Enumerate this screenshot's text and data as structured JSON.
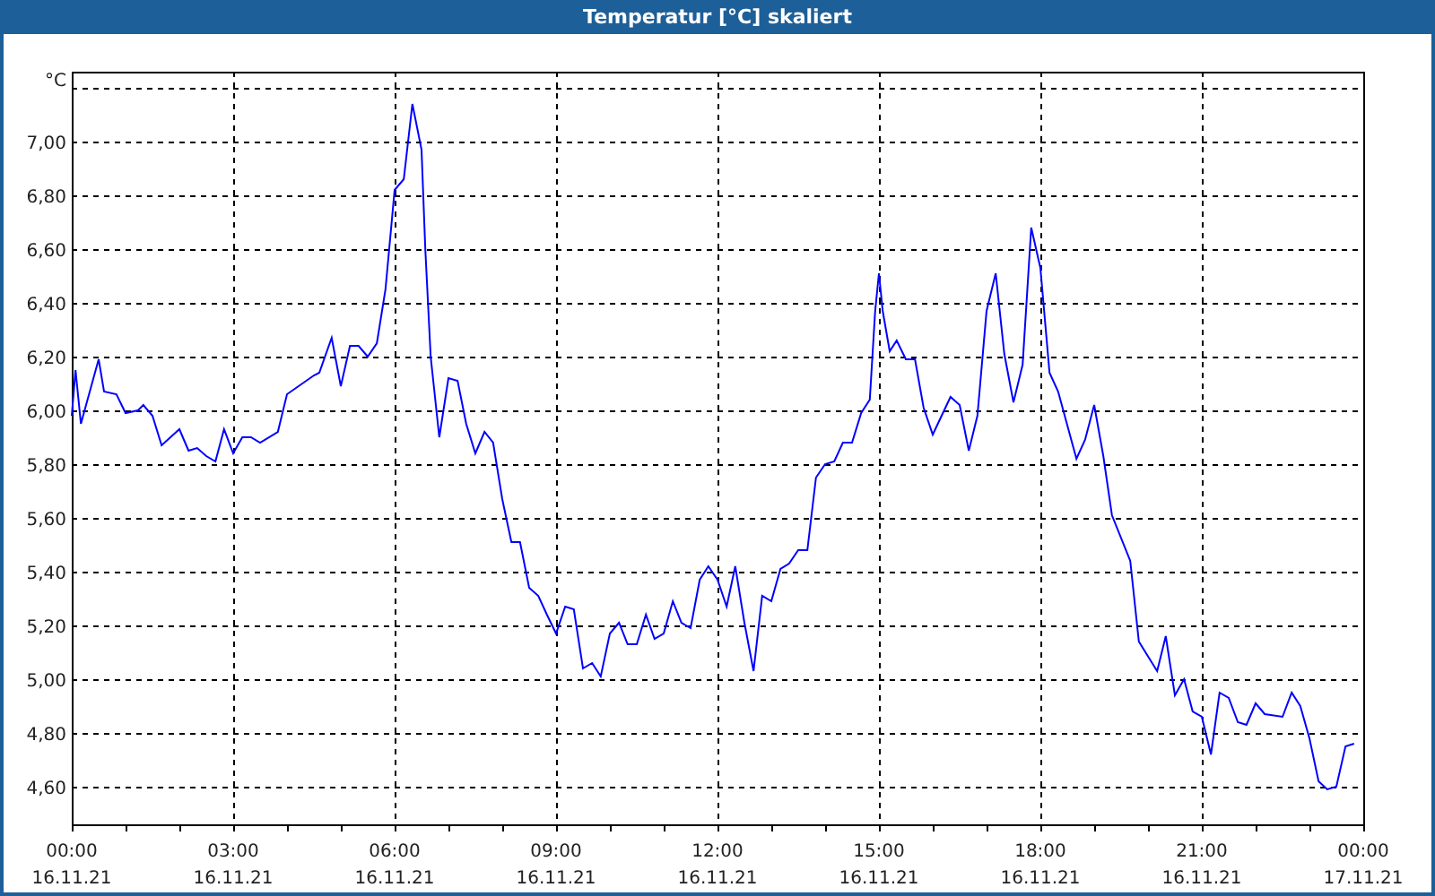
{
  "window": {
    "title": "Temperatur [°C] skaliert"
  },
  "chart": {
    "xtick_dates": [
      "16.11.21",
      "16.11.21",
      "16.11.21",
      "16.11.21",
      "16.11.21",
      "16.11.21",
      "16.11.21",
      "16.11.21",
      "17.11.21"
    ],
    "chart_data": {
      "type": "line",
      "grid": true,
      "ylabel": "°C",
      "xlim": [
        0,
        24
      ],
      "ylim": [
        4.46,
        7.26
      ],
      "xticks": [
        {
          "value": 0,
          "label": "00:00"
        },
        {
          "value": 3,
          "label": "03:00"
        },
        {
          "value": 6,
          "label": "06:00"
        },
        {
          "value": 9,
          "label": "09:00"
        },
        {
          "value": 12,
          "label": "12:00"
        },
        {
          "value": 15,
          "label": "15:00"
        },
        {
          "value": 18,
          "label": "18:00"
        },
        {
          "value": 21,
          "label": "21:00"
        },
        {
          "value": 24,
          "label": "00:00"
        }
      ],
      "yticks": [
        {
          "value": 4.6,
          "label": "4,60"
        },
        {
          "value": 4.8,
          "label": "4,80"
        },
        {
          "value": 5,
          "label": "5,00"
        },
        {
          "value": 5.2,
          "label": "5,20"
        },
        {
          "value": 5.4,
          "label": "5,40"
        },
        {
          "value": 5.6,
          "label": "5,60"
        },
        {
          "value": 5.8,
          "label": "5,80"
        },
        {
          "value": 6,
          "label": "6,00"
        },
        {
          "value": 6.2,
          "label": "6,20"
        },
        {
          "value": 6.4,
          "label": "6,40"
        },
        {
          "value": 6.6,
          "label": "6,60"
        },
        {
          "value": 6.8,
          "label": "6,80"
        },
        {
          "value": 7,
          "label": "7,00"
        }
      ],
      "x": [
        0,
        0.07,
        0.17,
        0.5,
        0.6,
        0.83,
        1,
        1.23,
        1.33,
        1.5,
        1.67,
        2,
        2.17,
        2.33,
        2.5,
        2.67,
        2.83,
        3,
        3.17,
        3.33,
        3.5,
        3.83,
        4,
        4.5,
        4.6,
        4.83,
        5,
        5.17,
        5.33,
        5.5,
        5.67,
        5.83,
        6,
        6.17,
        6.33,
        6.5,
        6.57,
        6.67,
        6.83,
        7,
        7.17,
        7.33,
        7.5,
        7.67,
        7.83,
        8,
        8.17,
        8.33,
        8.5,
        8.67,
        8.83,
        9,
        9.17,
        9.33,
        9.5,
        9.67,
        9.83,
        10,
        10.17,
        10.33,
        10.5,
        10.67,
        10.83,
        11,
        11.17,
        11.33,
        11.5,
        11.67,
        11.83,
        12,
        12.17,
        12.33,
        12.5,
        12.67,
        12.83,
        13,
        13.17,
        13.33,
        13.5,
        13.67,
        13.83,
        14,
        14.17,
        14.33,
        14.5,
        14.67,
        14.83,
        14.93,
        15,
        15.07,
        15.2,
        15.33,
        15.5,
        15.67,
        15.83,
        16,
        16.33,
        16.5,
        16.67,
        16.83,
        17,
        17.17,
        17.33,
        17.5,
        17.67,
        17.83,
        18,
        18.17,
        18.33,
        18.67,
        18.83,
        19,
        19.17,
        19.33,
        19.67,
        19.83,
        20.17,
        20.33,
        20.5,
        20.67,
        20.83,
        21,
        21.17,
        21.33,
        21.5,
        21.67,
        21.83,
        22,
        22.17,
        22.5,
        22.67,
        22.83,
        23,
        23.17,
        23.33,
        23.5,
        23.67,
        23.83
      ],
      "series": [
        {
          "color": "#0000ff",
          "values": [
            5.98,
            6.15,
            5.95,
            6.19,
            6.07,
            6.06,
            5.99,
            6.0,
            6.02,
            5.98,
            5.87,
            5.93,
            5.85,
            5.86,
            5.83,
            5.81,
            5.93,
            5.84,
            5.9,
            5.9,
            5.88,
            5.92,
            6.06,
            6.13,
            6.14,
            6.27,
            6.09,
            6.24,
            6.24,
            6.2,
            6.25,
            6.45,
            6.82,
            6.86,
            7.14,
            6.97,
            6.6,
            6.2,
            5.9,
            6.12,
            6.11,
            5.95,
            5.84,
            5.92,
            5.88,
            5.67,
            5.51,
            5.51,
            5.34,
            5.31,
            5.24,
            5.17,
            5.27,
            5.26,
            5.04,
            5.06,
            5.01,
            5.17,
            5.21,
            5.13,
            5.13,
            5.24,
            5.15,
            5.17,
            5.29,
            5.21,
            5.19,
            5.37,
            5.42,
            5.37,
            5.27,
            5.42,
            5.21,
            5.03,
            5.31,
            5.29,
            5.41,
            5.43,
            5.48,
            5.48,
            5.75,
            5.8,
            5.81,
            5.88,
            5.88,
            5.99,
            6.04,
            6.37,
            6.51,
            6.37,
            6.22,
            6.26,
            6.19,
            6.19,
            6.01,
            5.91,
            6.05,
            6.02,
            5.85,
            5.98,
            6.37,
            6.51,
            6.21,
            6.03,
            6.17,
            6.68,
            6.53,
            6.14,
            6.07,
            5.82,
            5.89,
            6.02,
            5.83,
            5.61,
            5.44,
            5.14,
            5.03,
            5.16,
            4.94,
            5.0,
            4.88,
            4.86,
            4.72,
            4.95,
            4.93,
            4.84,
            4.83,
            4.91,
            4.87,
            4.86,
            4.95,
            4.9,
            4.78,
            4.62,
            4.59,
            4.6,
            4.75,
            4.76
          ]
        }
      ]
    }
  }
}
